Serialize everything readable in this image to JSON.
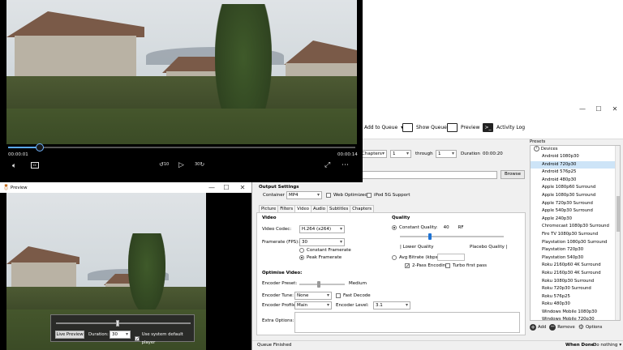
{
  "player": {
    "elapsed": "00:00:01",
    "total": "00:00:14",
    "progress_fraction": 0.09,
    "controls": {
      "volume_icon": "volume-icon",
      "captions_icon": "captions-icon",
      "rewind_label": "10",
      "forward_label": "30",
      "play_icon": "play-icon",
      "fullscreen_icon": "expand-icon",
      "more_icon": "more-icon"
    }
  },
  "preview": {
    "title": "Preview",
    "live_preview_button": "Live Preview",
    "duration_label": "Duration:",
    "duration_value": "30",
    "use_default_player_label": "Use system default player",
    "use_default_player_checked": true,
    "seek_fraction": 0.46
  },
  "handbrake": {
    "toolbar": {
      "add_to_queue": "Add to Queue",
      "add_to_queue_arrow": "▾",
      "show_queue": "Show Queue",
      "preview": "Preview",
      "activity_log": "Activity Log"
    },
    "range": {
      "mode": "Chapters",
      "from": "1",
      "through_label": "through",
      "to": "1",
      "duration_label": "Duration",
      "duration_value": "00:00:20"
    },
    "browse_button": "Browse",
    "output_settings": {
      "heading": "Output Settings",
      "container_label": "Container",
      "container_value": "MP4",
      "web_optimized_label": "Web Optimized",
      "web_optimized_checked": false,
      "ipod_label": "iPod 5G Support",
      "ipod_checked": false
    },
    "tabs": [
      "Picture",
      "Filters",
      "Video",
      "Audio",
      "Subtitles",
      "Chapters"
    ],
    "active_tab": "Video",
    "video": {
      "section_label": "Video",
      "codec_label": "Video Codec:",
      "codec_value": "H.264 (x264)",
      "framerate_label": "Framerate (FPS):",
      "framerate_value": "30",
      "constant_framerate": "Constant Framerate",
      "peak_framerate": "Peak Framerate",
      "peak_selected": true
    },
    "quality": {
      "section_label": "Quality",
      "constant_quality_label": "Constant Quality:",
      "constant_quality_value": "40",
      "rf_label": "RF",
      "lower_quality": "| Lower Quality",
      "placebo_quality": "Placebo Quality |",
      "avg_bitrate_label": "Avg Bitrate (kbps):",
      "two_pass_label": "2-Pass Encoding",
      "two_pass_checked": true,
      "turbo_label": "Turbo first pass",
      "turbo_checked": false,
      "slider_fraction": 0.29
    },
    "optimise": {
      "section_label": "Optimise Video:",
      "preset_label": "Encoder Preset:",
      "preset_value": "Medium",
      "preset_fraction": 0.43,
      "tune_label": "Encoder Tune:",
      "tune_value": "None",
      "fast_decode_label": "Fast Decode",
      "profile_label": "Encoder Profile:",
      "profile_value": "Main",
      "level_label": "Encoder Level:",
      "level_value": "3.1",
      "extra_options_label": "Extra Options:"
    },
    "presets": {
      "heading": "Presets",
      "group": "Devices",
      "items": [
        "Android 1080p30",
        "Android 720p30",
        "Android 576p25",
        "Android 480p30",
        "Apple 1080p60 Surround",
        "Apple 1080p30 Surround",
        "Apple 720p30 Surround",
        "Apple 540p30 Surround",
        "Apple 240p30",
        "Chromecast 1080p30 Surround",
        "Fire TV 1080p30 Surround",
        "Playstation 1080p30 Surround",
        "Playstation 720p30",
        "Playstation 540p30",
        "Roku 2160p60 4K Surround",
        "Roku 2160p30 4K Surround",
        "Roku 1080p30 Surround",
        "Roku 720p30 Surround",
        "Roku 576p25",
        "Roku 480p30",
        "Windows Mobile 1080p30",
        "Windows Mobile 720p30"
      ],
      "selected_index": 1,
      "add_label": "Add",
      "remove_label": "Remove",
      "options_label": "Options"
    },
    "status": {
      "message": "Queue Finished",
      "when_done_label": "When Done:",
      "when_done_value": "Do nothing"
    }
  }
}
